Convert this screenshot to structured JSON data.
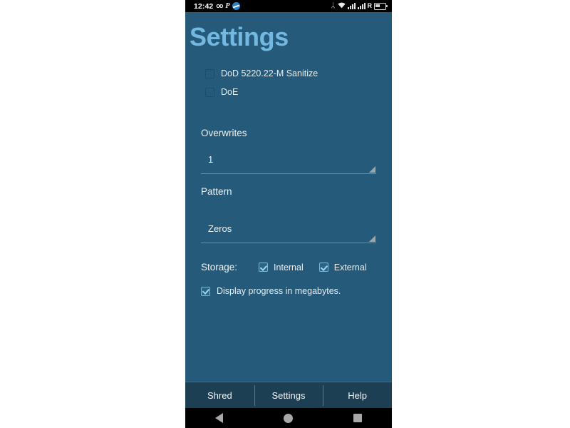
{
  "statusbar": {
    "clock": "12:42",
    "icons_left": [
      "voicemail-icon",
      "parking-p-icon",
      "sync-icon"
    ],
    "icons_right": [
      "bluetooth-icon",
      "wifi-icon",
      "signal-bars-sim1-icon",
      "signal-bars-sim2-icon",
      "roaming-r-icon",
      "battery-icon"
    ],
    "voicemail_glyph": "oo",
    "parking_glyph": "P",
    "bluetooth_glyph": "ᛦ",
    "wifi_glyph": "▲",
    "roaming_glyph": "R"
  },
  "app": {
    "title": "Settings",
    "title_color": "#73b8e0",
    "background_color": "#255a7a"
  },
  "options": {
    "dod": {
      "label": "DoD 5220.22-M Sanitize",
      "checked": false
    },
    "doe": {
      "label": "DoE",
      "checked": false
    }
  },
  "overwrites": {
    "label": "Overwrites",
    "value": "1"
  },
  "pattern": {
    "label": "Pattern",
    "value": "Zeros"
  },
  "storage": {
    "label": "Storage:",
    "internal": {
      "label": "Internal",
      "checked": true
    },
    "external": {
      "label": "External",
      "checked": true
    }
  },
  "progress": {
    "label": "Display progress in megabytes.",
    "checked": true
  },
  "tabs": [
    {
      "label": "Shred"
    },
    {
      "label": "Settings"
    },
    {
      "label": "Help"
    }
  ],
  "navbar": {
    "back": "back-icon",
    "home": "home-icon",
    "recents": "recents-icon"
  }
}
